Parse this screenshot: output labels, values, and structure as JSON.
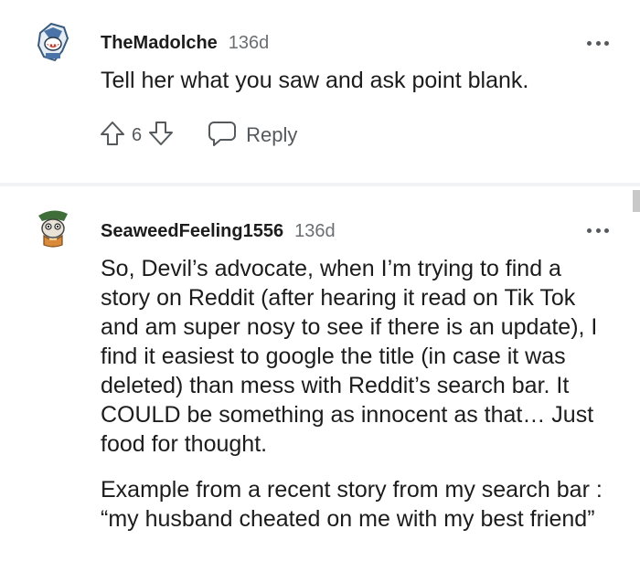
{
  "comments": [
    {
      "username": "TheMadolche",
      "age": "136d",
      "text": "Tell her what you saw and ask point blank.",
      "votes": "6",
      "reply_label": "Reply"
    },
    {
      "username": "SeaweedFeeling1556",
      "age": "136d",
      "paragraphs": [
        "So, Devil’s advocate, when I’m trying to find a story on Reddit (after hearing it read on Tik Tok and am super nosy to see if there is an update), I find it easiest to google the title (in case it was deleted) than mess with Reddit’s search bar. It COULD be something as innocent as that… Just food for thought.",
        "Example from a recent story from my search bar : “my husband cheated on me with my best friend”"
      ]
    }
  ],
  "icons": {
    "upvote": "upvote-arrow-icon",
    "downvote": "downvote-arrow-icon",
    "reply": "speech-bubble-icon",
    "more": "more-options-icon"
  },
  "colors": {
    "text": "#1c1c1c",
    "meta": "#6b6f72",
    "icon": "#55595c",
    "divider": "#f2f3f5"
  }
}
